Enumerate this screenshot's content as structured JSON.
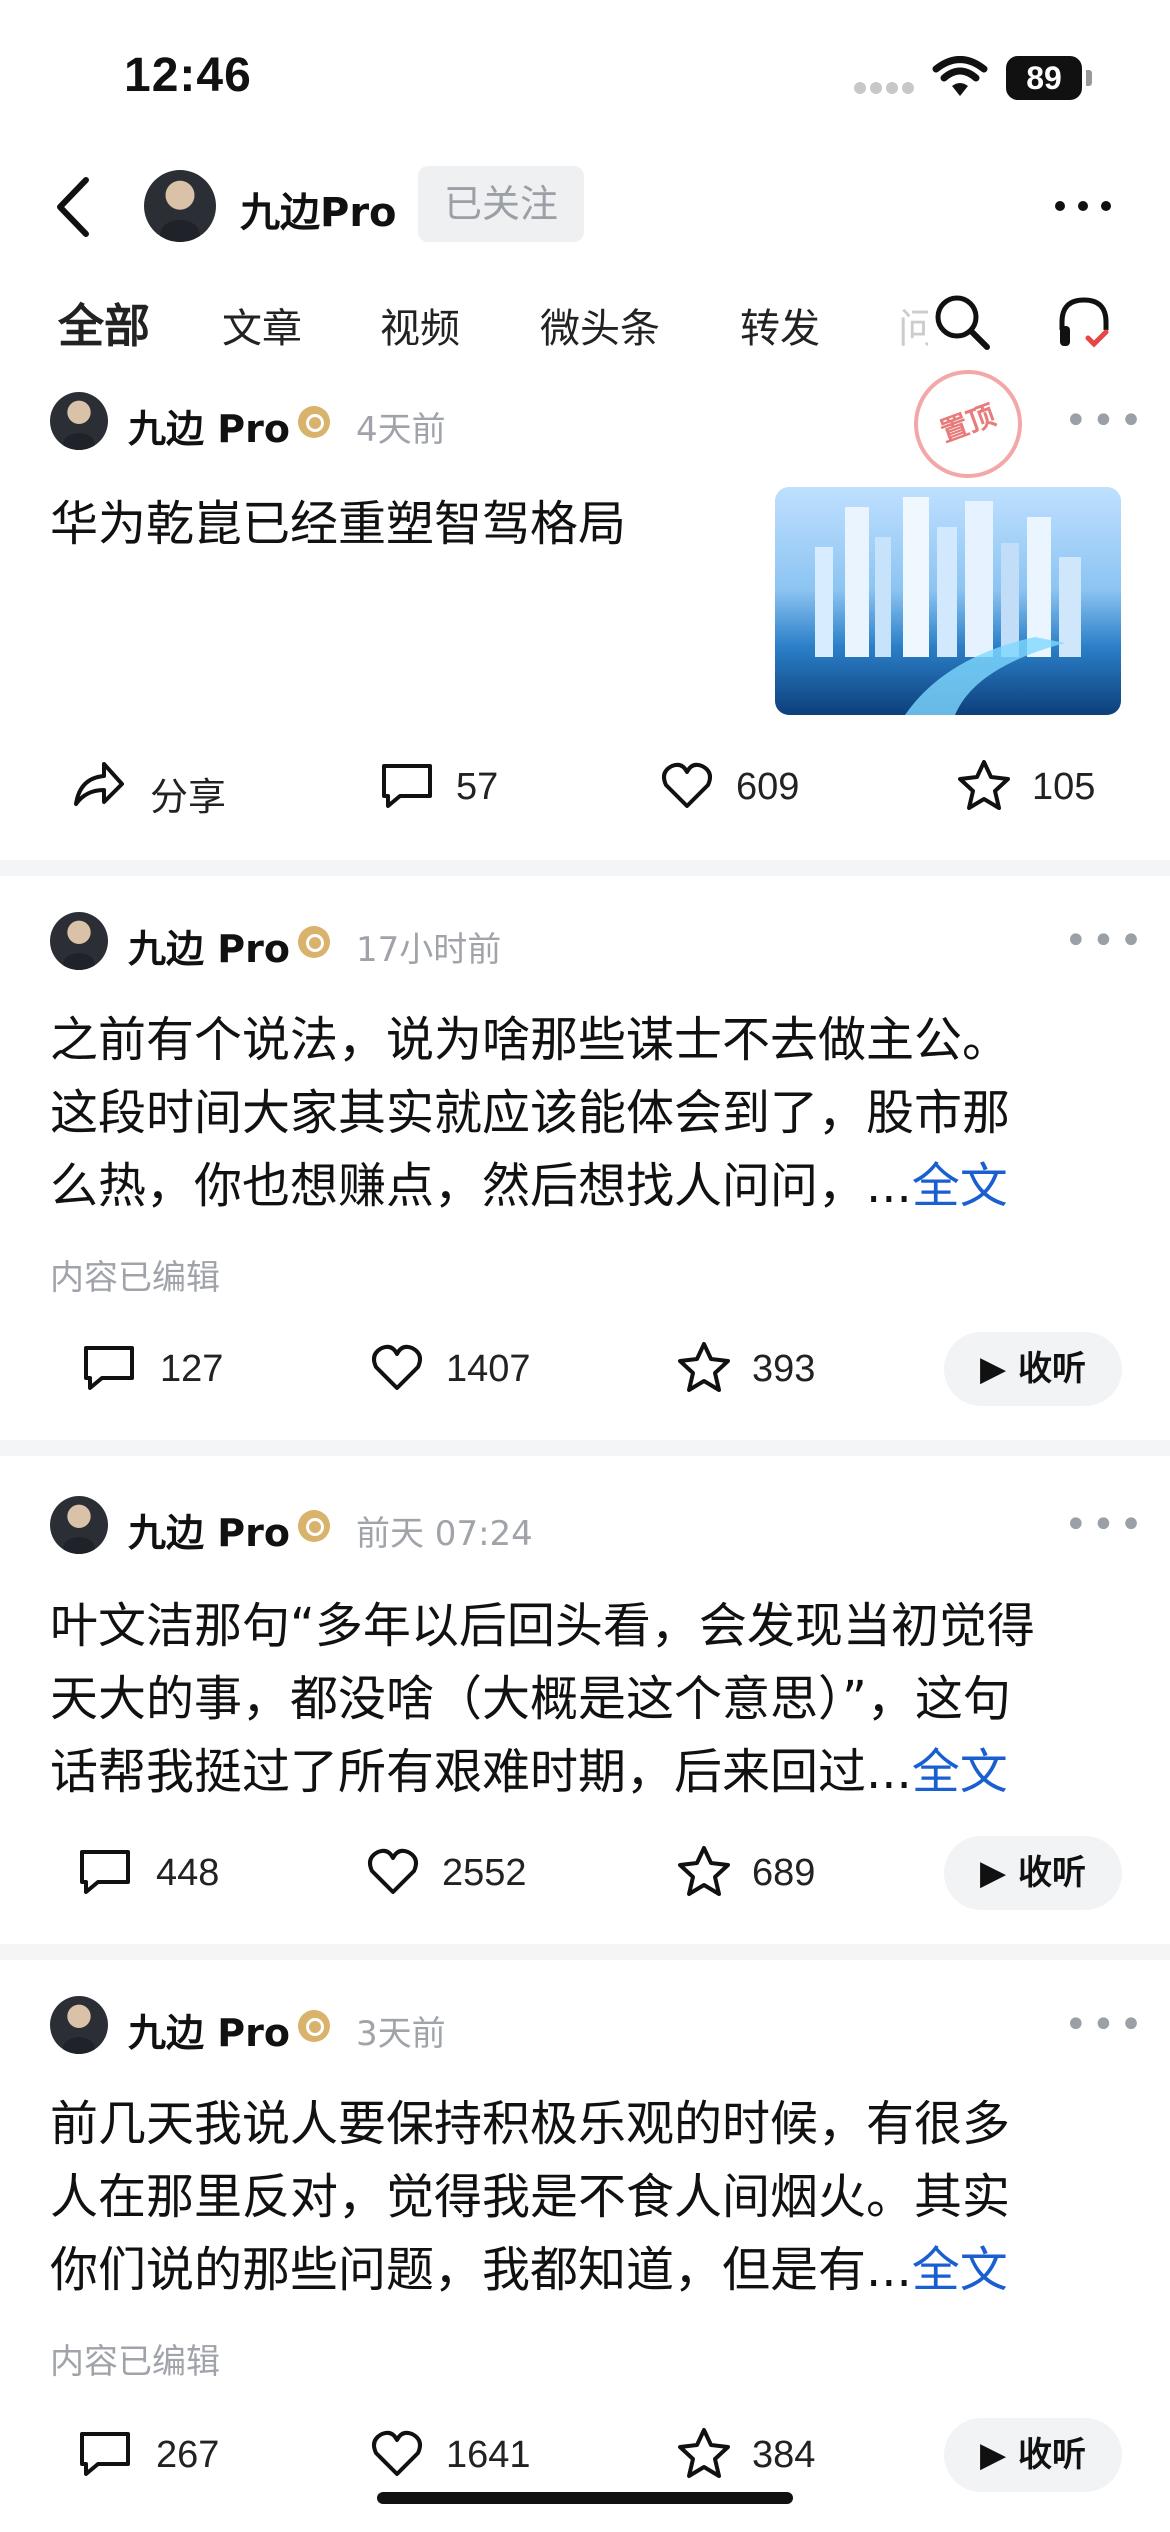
{
  "status_bar": {
    "time": "12:46",
    "battery": "89"
  },
  "header": {
    "name": "九边Pro",
    "follow_label": "已关注"
  },
  "tabs": [
    {
      "label": "全部"
    },
    {
      "label": "文章"
    },
    {
      "label": "视频"
    },
    {
      "label": "微头条"
    },
    {
      "label": "转发"
    },
    {
      "label": "问"
    }
  ],
  "posts": [
    {
      "author": "九边 Pro",
      "time": "4天前",
      "badge": "置顶",
      "text": "华为乾崑已经重塑智驾格局",
      "share_label": "分享",
      "comments": "57",
      "likes": "609",
      "favorites": "105"
    },
    {
      "author": "九边 Pro",
      "time": "17小时前",
      "lines": [
        "之前有个说法，说为啥那些谋士不去做主公。",
        "这段时间大家其实就应该能体会到了，股市那",
        "么热，你也想赚点，然后想找人问问，..."
      ],
      "fulltext": "全文",
      "edited": "内容已编辑",
      "comments": "127",
      "likes": "1407",
      "favorites": "393",
      "listen": "收听"
    },
    {
      "author": "九边 Pro",
      "time": "前天 07:24",
      "lines": [
        "叶文洁那句“多年以后回头看，会发现当初觉得",
        "天大的事，都没啥（大概是这个意思）”，这句",
        "话帮我挺过了所有艰难时期，后来回过..."
      ],
      "fulltext": "全文",
      "comments": "448",
      "likes": "2552",
      "favorites": "689",
      "listen": "收听"
    },
    {
      "author": "九边 Pro",
      "time": "3天前",
      "lines": [
        "前几天我说人要保持积极乐观的时候，有很多",
        "人在那里反对，觉得我是不食人间烟火。其实",
        "你们说的那些问题，我都知道，但是有..."
      ],
      "fulltext": "全文",
      "edited": "内容已编辑",
      "comments": "267",
      "likes": "1641",
      "favorites": "384",
      "listen": "收听"
    }
  ]
}
